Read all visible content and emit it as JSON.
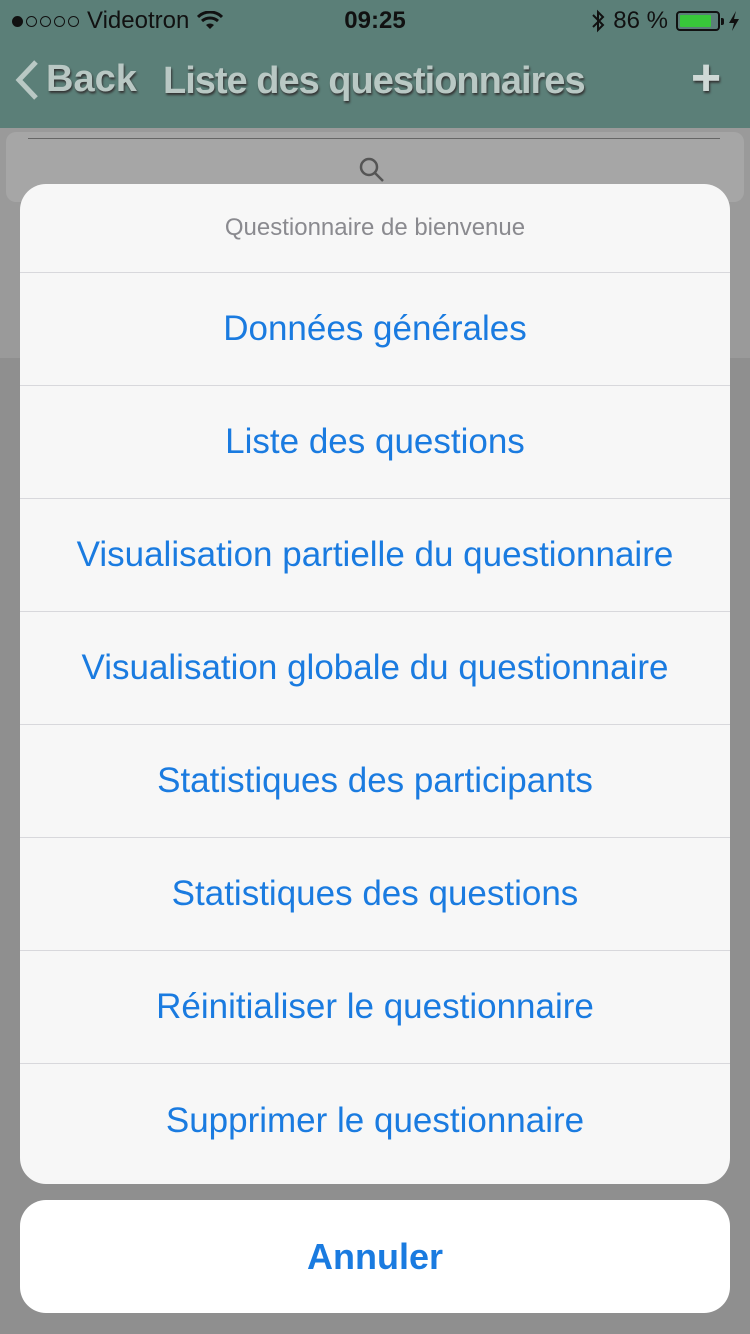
{
  "status_bar": {
    "carrier": "Videotron",
    "time": "09:25",
    "battery": "86 %",
    "battery_level": 0.86
  },
  "nav": {
    "back_label": "Back",
    "title": "Liste des questionnaires",
    "add_label": "+"
  },
  "action_sheet": {
    "title": "Questionnaire de bienvenue",
    "items": [
      "Données générales",
      "Liste des questions",
      "Visualisation partielle du questionnaire",
      "Visualisation globale du questionnaire",
      "Statistiques des participants",
      "Statistiques des questions",
      "Réinitialiser le questionnaire",
      "Supprimer le questionnaire"
    ],
    "cancel_label": "Annuler"
  },
  "colors": {
    "accent": "#1a7be0",
    "navbar": "#5b7f78"
  },
  "icons": [
    "signal-dots-icon",
    "wifi-icon",
    "bluetooth-icon",
    "battery-icon",
    "charging-icon",
    "back-chevron-icon",
    "search-icon"
  ]
}
